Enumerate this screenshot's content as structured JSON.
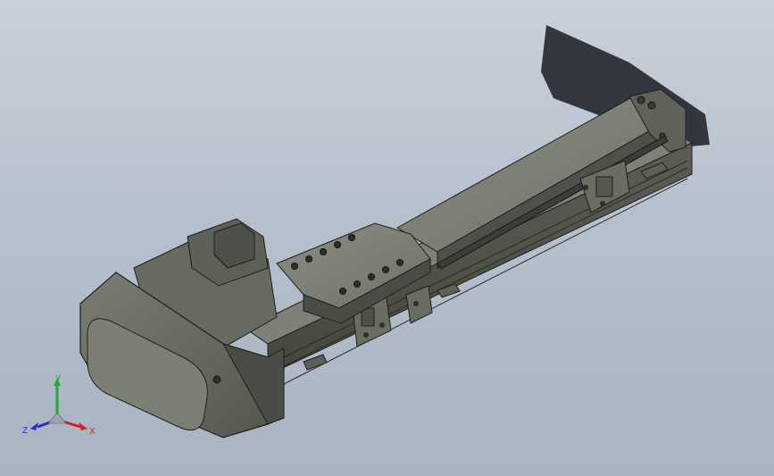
{
  "viewport": {
    "background_top": "#c9d0da",
    "background_bottom": "#a9b3c1",
    "model_color": "#6b6e64",
    "model_edge_color": "#23241f",
    "shadow_color": "#2a2d33"
  },
  "triad": {
    "x_label": "X",
    "y_label": "Y",
    "z_label": "Z",
    "x_color": "#d42020",
    "y_color": "#22a83a",
    "z_color": "#2630c8"
  }
}
